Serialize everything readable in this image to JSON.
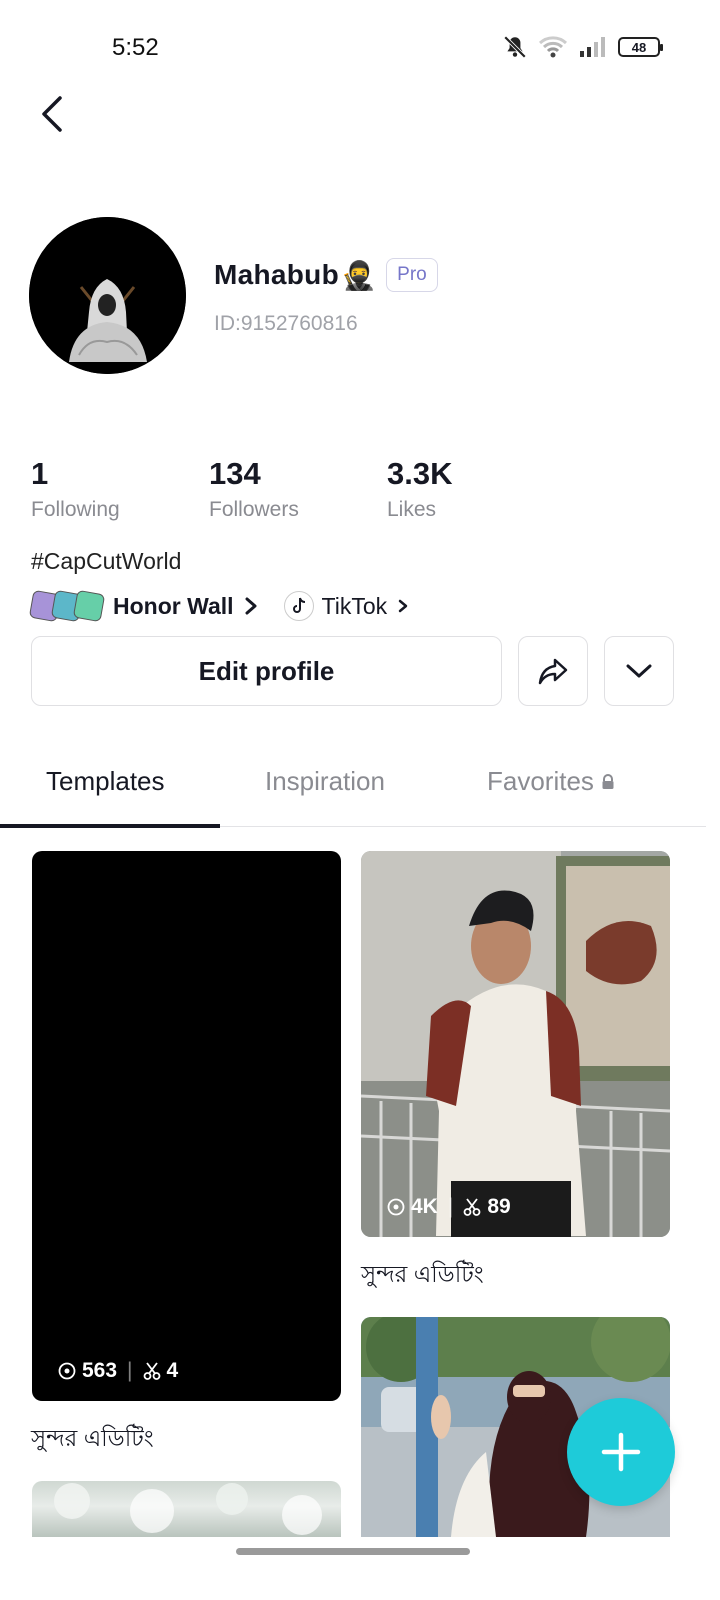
{
  "status_bar": {
    "time": "5:52",
    "battery": "48"
  },
  "profile": {
    "username": "Mahabub",
    "username_emoji": "🥷",
    "badge": "Pro",
    "user_id": "ID:9152760816"
  },
  "stats": [
    {
      "value": "1",
      "label": "Following"
    },
    {
      "value": "134",
      "label": "Followers"
    },
    {
      "value": "3.3K",
      "label": "Likes"
    }
  ],
  "bio": "#CapCutWorld",
  "links": {
    "honor_wall": "Honor Wall",
    "tiktok": "TikTok"
  },
  "buttons": {
    "edit_profile": "Edit profile"
  },
  "tabs": [
    {
      "label": "Templates",
      "active": true
    },
    {
      "label": "Inspiration",
      "active": false
    },
    {
      "label": "Favorites",
      "active": false,
      "locked": true
    }
  ],
  "templates": [
    {
      "views": "563",
      "uses": "4",
      "title": "সুন্দর এডিটিং"
    },
    {
      "views": "4K",
      "uses": "89",
      "title": "সুন্দর এডিটিং"
    }
  ],
  "colors": {
    "fab": "#1ecbd9",
    "pro_badge": "#7676c9",
    "text_primary": "#161823",
    "text_secondary": "#8a8b91"
  },
  "icons": [
    "back-icon",
    "mute-icon",
    "wifi-icon",
    "signal-icon",
    "battery-icon",
    "share-icon",
    "chevron-down-icon",
    "lock-icon",
    "eye-icon",
    "scissors-icon",
    "plus-icon"
  ]
}
